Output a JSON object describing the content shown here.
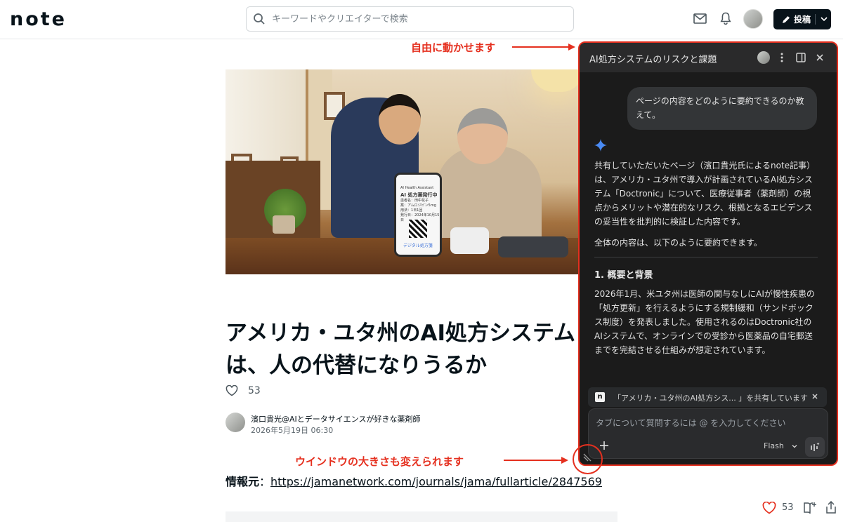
{
  "header": {
    "logo": "note",
    "search_placeholder": "キーワードやクリエイターで検索",
    "post_label": "投稿"
  },
  "article": {
    "title": "アメリカ・ユタ州のAI処方システムは、人の代替になりうるか",
    "like_count": "53",
    "author_name": "濱口貴光@AIとデータサイエンスが好きな薬剤師",
    "date": "2026年5月19日 06:30",
    "source_label": "情報元",
    "source_sep": "：",
    "source_url": "https://jamanetwork.com/journals/jama/fullarticle/2847569",
    "phone_text": [
      "AI Health Assistant",
      "AI 処方薬発行中",
      "患者名：田中花子",
      "薬：アムロジピン5mg",
      "用法：1日1回",
      "発行日：2024年10月15日",
      "デジタル処方箋"
    ]
  },
  "annotations": {
    "move_note": "自由に動かせます",
    "resize_note": "ウインドウの大きさも変えられます",
    "color": "#e5301f"
  },
  "panel": {
    "title": "AI処方システムのリスクと課題",
    "user_message": "ページの内容をどのように要約できるのか教えて。",
    "response_p1": "共有していただいたページ（濱口貴光氏によるnote記事）は、アメリカ・ユタ州で導入が計画されているAI処方システム「Doctronic」について、医療従事者（薬剤師）の視点からメリットや潜在的なリスク、根拠となるエビデンスの妥当性を批判的に検証した内容です。",
    "response_p2": "全体の内容は、以下のように要約できます。",
    "section_heading": "1. 概要と背景",
    "section_body": "2026年1月、米ユタ州は医師の関与なしにAIが慢性疾患の「処方更新」を行えるようにする規制緩和（サンドボックス制度）を発表しました。使用されるのはDoctronic社のAIシステムで、オンラインでの受診から医薬品の自宅郵送までを完結させる仕組みが想定されています。",
    "share_text": "「アメリカ・ユタ州のAI処方シス... 」を共有しています",
    "share_icon": "n",
    "input_placeholder": "タブについて質問するには @ を入力してください",
    "model_label": "Flash",
    "accent": "#4a8bf5"
  },
  "footer": {
    "like_count": "53"
  }
}
